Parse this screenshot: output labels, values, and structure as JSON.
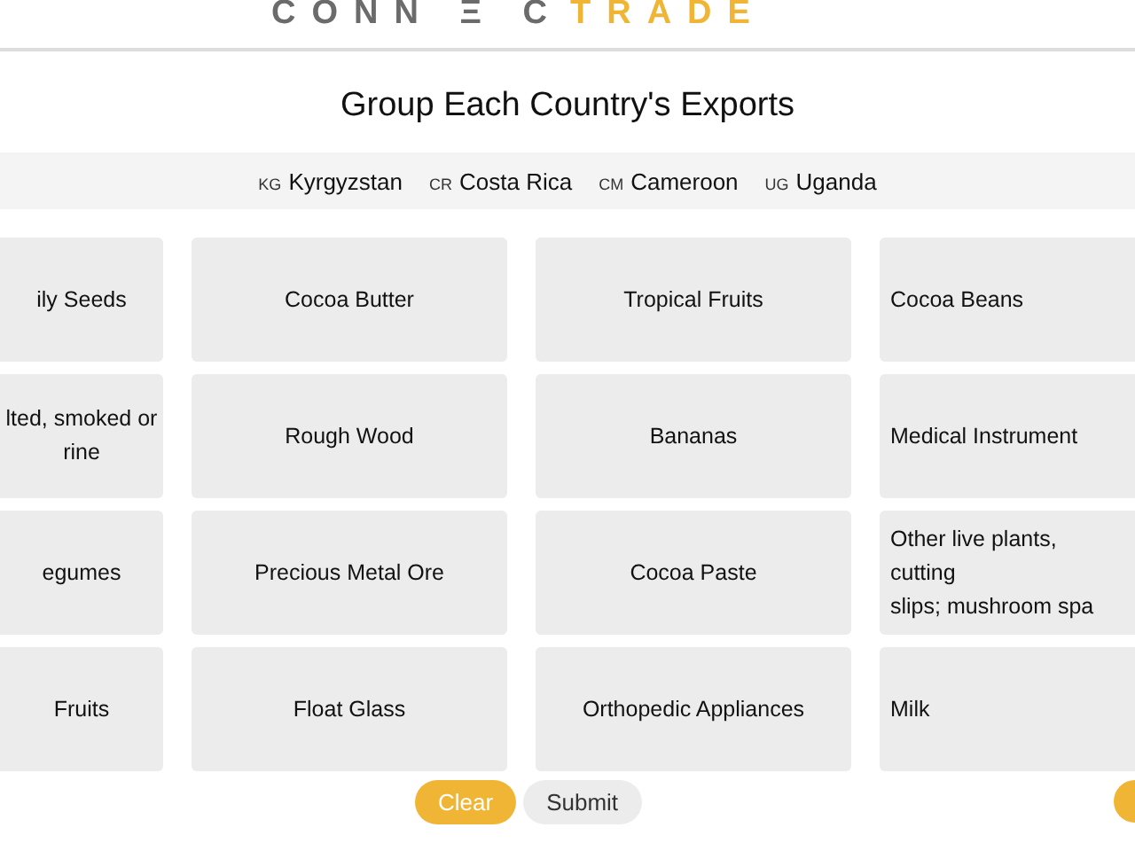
{
  "logo": {
    "primary": "CONN Ξ C",
    "accent": "TRADE"
  },
  "title": "Group Each Country's Exports",
  "countries": [
    {
      "code": "KG",
      "name": "Kyrgyzstan"
    },
    {
      "code": "CR",
      "name": "Costa Rica"
    },
    {
      "code": "CM",
      "name": "Cameroon"
    },
    {
      "code": "UG",
      "name": "Uganda"
    }
  ],
  "cards": [
    {
      "label": "ily Seeds"
    },
    {
      "label": "Cocoa Butter"
    },
    {
      "label": "Tropical Fruits"
    },
    {
      "label": "Cocoa Beans"
    },
    {
      "label": "lted, smoked or\nrine"
    },
    {
      "label": "Rough Wood"
    },
    {
      "label": "Bananas"
    },
    {
      "label": "Medical Instrument"
    },
    {
      "label": "egumes"
    },
    {
      "label": "Precious Metal Ore"
    },
    {
      "label": "Cocoa Paste"
    },
    {
      "label": "Other live plants, cutting\nslips; mushroom spa"
    },
    {
      "label": "Fruits"
    },
    {
      "label": "Float Glass"
    },
    {
      "label": "Orthopedic Appliances"
    },
    {
      "label": "Milk"
    }
  ],
  "buttons": [
    {
      "label": "Clear",
      "kind": "primary"
    },
    {
      "label": "Submit",
      "kind": "secondary"
    }
  ]
}
